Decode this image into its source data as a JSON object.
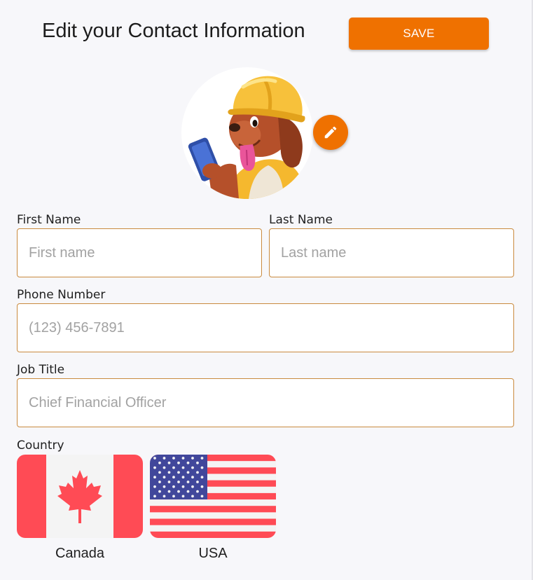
{
  "header": {
    "title": "Edit your Contact Information",
    "save_label": "SAVE"
  },
  "avatar": {
    "icon": "cartoon-dog-construction-worker-icon",
    "edit_icon": "pencil-icon"
  },
  "form": {
    "first_name": {
      "label": "First Name",
      "placeholder": "First name",
      "value": ""
    },
    "last_name": {
      "label": "Last Name",
      "placeholder": "Last name",
      "value": ""
    },
    "phone": {
      "label": "Phone Number",
      "placeholder": "(123) 456-7891",
      "value": ""
    },
    "job_title": {
      "label": "Job Title",
      "placeholder": "Chief Financial Officer",
      "value": ""
    },
    "country": {
      "label": "Country",
      "options": [
        {
          "name": "Canada",
          "icon": "canada-flag-icon"
        },
        {
          "name": "USA",
          "icon": "usa-flag-icon"
        }
      ]
    }
  },
  "colors": {
    "accent": "#ef7100",
    "field_border": "#c98a3e",
    "background": "#f7f7fa"
  }
}
